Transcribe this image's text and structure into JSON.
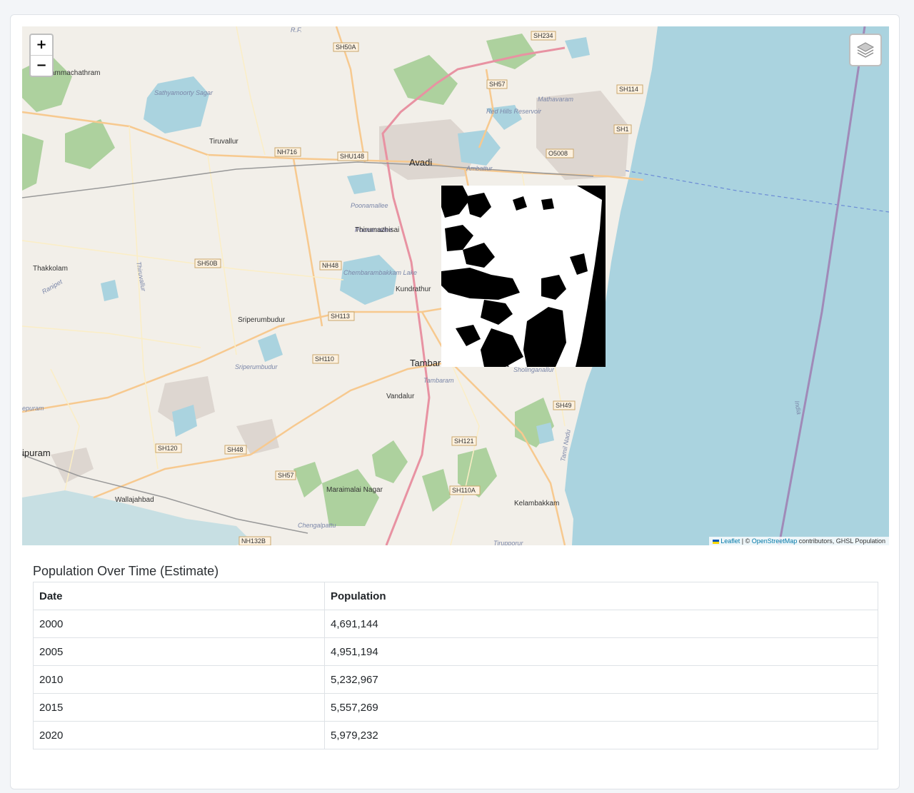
{
  "map": {
    "zoom_in": "+",
    "zoom_out": "−",
    "layers_icon": "layers-icon",
    "attribution": {
      "leaflet": "Leaflet",
      "sep": " | © ",
      "osm": "OpenStreetMap",
      "rest": " contributors, GHSL Population"
    },
    "places": [
      {
        "name": "ammachathram",
        "cls": "town"
      },
      {
        "name": "Sathyamoorty Sagar",
        "cls": "water"
      },
      {
        "name": "Tiruvallur",
        "cls": "town"
      },
      {
        "name": "Avadi",
        "cls": "city"
      },
      {
        "name": "Ambattur",
        "cls": "water"
      },
      {
        "name": "Mathavaram",
        "cls": "water"
      },
      {
        "name": "Red Hills Reservoir",
        "cls": "water"
      },
      {
        "name": "Poonamallee",
        "cls": "water"
      },
      {
        "name": "Thirumazhisai",
        "cls": "town"
      },
      {
        "name": "Thakkolam",
        "cls": "town"
      },
      {
        "name": "Chembarambakkam Lake",
        "cls": "water"
      },
      {
        "name": "Kundrathur",
        "cls": "town"
      },
      {
        "name": "Sriperumbudur",
        "cls": "town"
      },
      {
        "name": "Sriperumbudur",
        "cls": "water"
      },
      {
        "name": "Tambaram",
        "cls": "city"
      },
      {
        "name": "Tambaram",
        "cls": "water"
      },
      {
        "name": "Sholinganallur",
        "cls": "water"
      },
      {
        "name": "Vandalur",
        "cls": "town"
      },
      {
        "name": "ipuram",
        "cls": "city"
      },
      {
        "name": "Wallajahbad",
        "cls": "town"
      },
      {
        "name": "Maraimalai Nagar",
        "cls": "town"
      },
      {
        "name": "Chengalpattu",
        "cls": "water"
      },
      {
        "name": "Kelambakkam",
        "cls": "town"
      },
      {
        "name": "Tirupporur",
        "cls": "water"
      },
      {
        "name": "Tamil Nadu",
        "cls": "water"
      },
      {
        "name": "India",
        "cls": "water"
      },
      {
        "name": "Ranipet",
        "cls": "water"
      },
      {
        "name": "Thiruvallur",
        "cls": "water"
      },
      {
        "name": "epuram",
        "cls": "water"
      },
      {
        "name": "R.F.",
        "cls": "water"
      }
    ],
    "shields": [
      "SH234",
      "SH50A",
      "SH57",
      "SH114",
      "SH1",
      "O5008",
      "NH716",
      "SHU148",
      "SH50B",
      "NH48",
      "SH113",
      "SH110",
      "SH49",
      "SH121",
      "SH120",
      "SH48",
      "SH57",
      "SH110A",
      "NH132B"
    ]
  },
  "table": {
    "title": "Population Over Time (Estimate)",
    "headers": [
      "Date",
      "Population"
    ],
    "rows": [
      [
        "2000",
        "4,691,144"
      ],
      [
        "2005",
        "4,951,194"
      ],
      [
        "2010",
        "5,232,967"
      ],
      [
        "2015",
        "5,557,269"
      ],
      [
        "2020",
        "5,979,232"
      ]
    ]
  }
}
